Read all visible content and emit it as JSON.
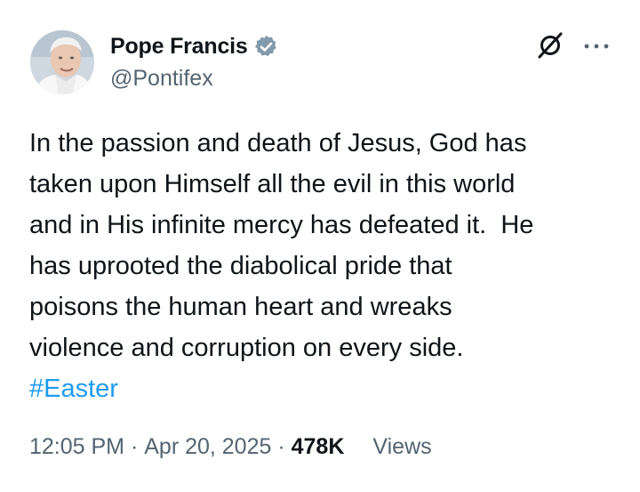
{
  "author": {
    "display_name": "Pope Francis",
    "handle": "@Pontifex",
    "verified_icon": "verified-badge-icon",
    "verified_color": "#829aab"
  },
  "actions": {
    "grok_icon": "grok-icon",
    "more_icon": "more-options-icon"
  },
  "post": {
    "text": "In the passion and death of Jesus, God has\ntaken upon Himself all the evil in this world\nand in His infinite mercy has defeated it.  He\nhas uprooted the diabolical pride that\npoisons the human heart and wreaks\nviolence and corruption on every side.\n",
    "hashtag": "#Easter",
    "hashtag_color": "#1d9bf0"
  },
  "meta": {
    "time": "12:05 PM",
    "separator": " · ",
    "date": "Apr 20, 2025",
    "views_count": "478K",
    "views_label": "Views"
  }
}
